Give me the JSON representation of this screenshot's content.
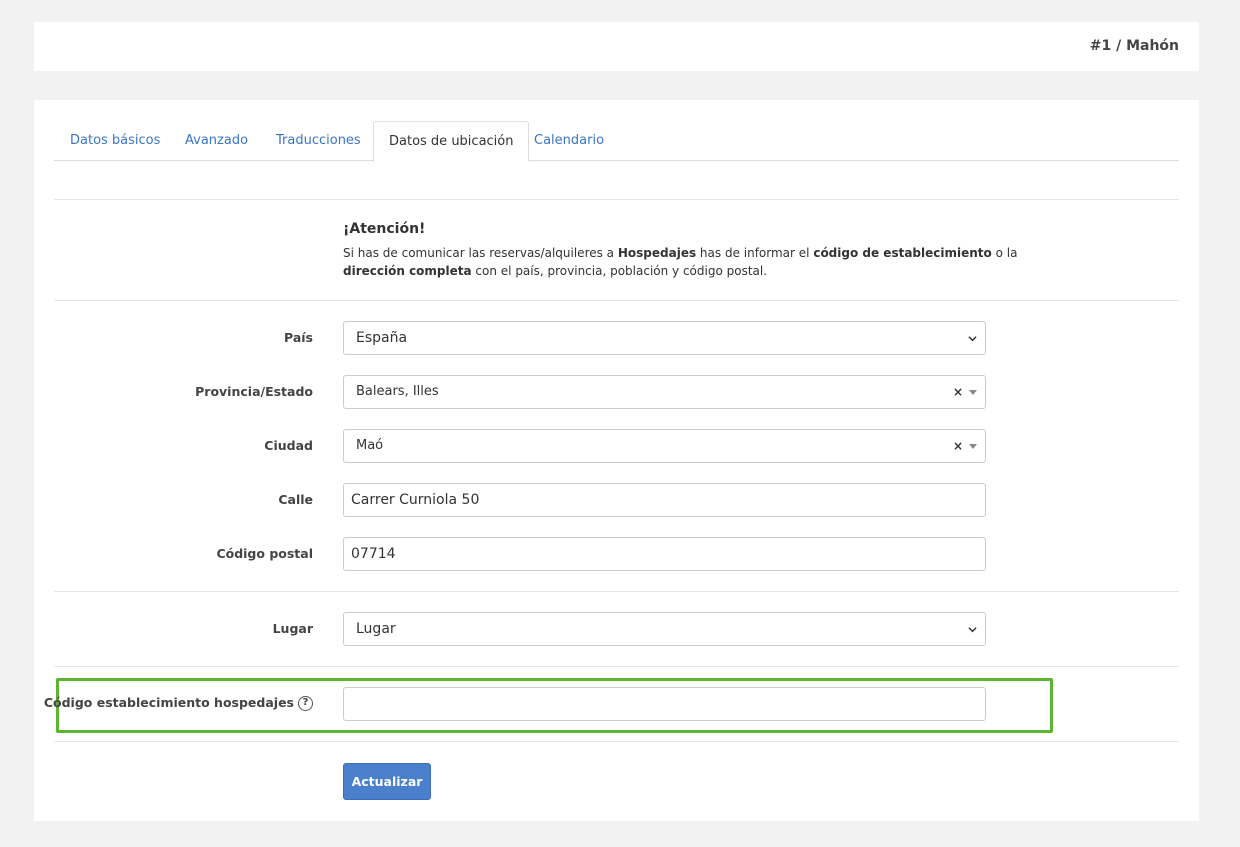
{
  "header": {
    "breadcrumb": "#1 / Mahón"
  },
  "tabs": [
    {
      "label": "Datos básicos"
    },
    {
      "label": "Avanzado"
    },
    {
      "label": "Traducciones"
    },
    {
      "label": "Datos de ubicación",
      "active": true
    },
    {
      "label": "Calendario"
    }
  ],
  "attention": {
    "title": "¡Atención!",
    "t1": "Si has de comunicar las reservas/alquileres a ",
    "b1": "Hospedajes",
    "t2": " has de informar el ",
    "b2": "código de establecimiento",
    "t3": " o la ",
    "b3": "dirección completa",
    "t4": " con el país, provincia, población y código postal."
  },
  "form": {
    "pais": {
      "label": "País",
      "value": "España"
    },
    "provincia": {
      "label": "Provincia/Estado",
      "value": "Balears, Illes",
      "clear": "×"
    },
    "ciudad": {
      "label": "Ciudad",
      "value": "Maó",
      "clear": "×"
    },
    "calle": {
      "label": "Calle",
      "value": "Carrer Curniola 50"
    },
    "cp": {
      "label": "Código postal",
      "value": "07714"
    },
    "lugar": {
      "label": "Lugar",
      "value": "Lugar"
    },
    "codigo": {
      "label": "Código establecimiento hospedajes",
      "value": "",
      "help": "?"
    },
    "submit": "Actualizar"
  },
  "colors": {
    "accent": "#4a7fcb",
    "link": "#3a76c4",
    "highlight": "#5cb531"
  }
}
